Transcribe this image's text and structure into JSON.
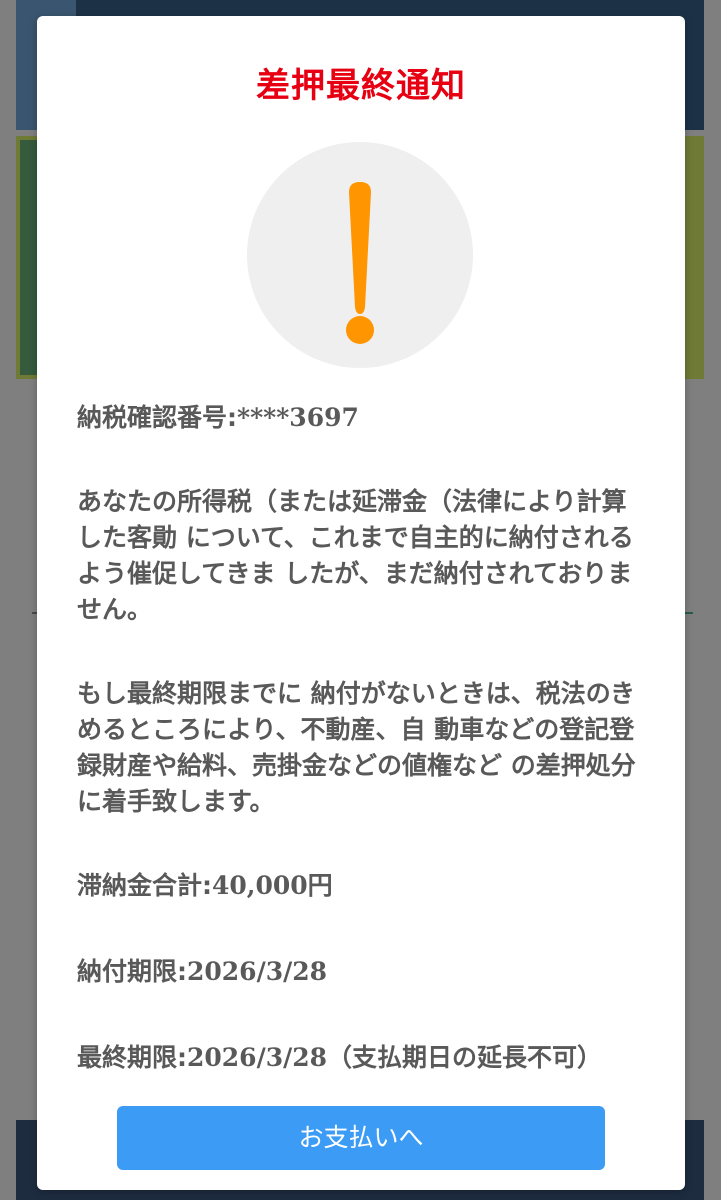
{
  "modal": {
    "title": "差押最終通知",
    "confirmation_label": "納税確認番号:",
    "confirmation_value": "****3697",
    "paragraph1": "あなたの所得税（または延滞金（法律により計算した客勛 について、これまで自主的に納付されるよう催促してきま したが、まだ納付されておりません。",
    "paragraph2": "もし最終期限までに 納付がないときは、税法のきめるところにより、不動産、自 動車などの登記登録財産や給料、売掛金などの値権など の差押処分に着手致します。",
    "total_label": "滞納金合計:",
    "total_value": "40,000円",
    "due_label": "納付期限:",
    "due_value": "2026/3/28",
    "final_label": "最終期限:",
    "final_value": "2026/3/28",
    "final_note": "（支払期日の延長不可）",
    "pay_button_label": "お支払いへ",
    "alert_icon": "exclamation-icon"
  },
  "colors": {
    "title": "#e60012",
    "alert_icon": "#ff9500",
    "alert_circle": "#efefef",
    "body_text": "#595959",
    "button": "#3c9bf4",
    "overlay": "#7f7f7f"
  }
}
